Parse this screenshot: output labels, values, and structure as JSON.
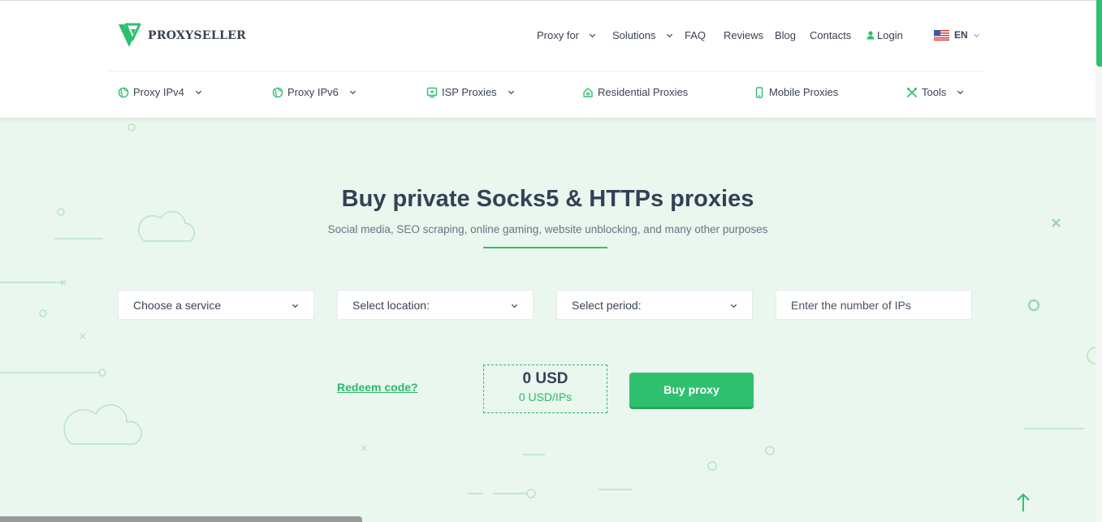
{
  "brand": {
    "name": "PROXYSELLER"
  },
  "top_nav": [
    {
      "label": "Proxy for",
      "dropdown": true
    },
    {
      "label": "Solutions",
      "dropdown": true
    },
    {
      "label": "FAQ",
      "dropdown": false
    },
    {
      "label": "Reviews",
      "dropdown": false
    },
    {
      "label": "Blog",
      "dropdown": false
    },
    {
      "label": "Contacts",
      "dropdown": false
    },
    {
      "label": "Login",
      "icon": "user-icon"
    },
    {
      "label": "EN",
      "icon": "us-flag-icon",
      "dropdown": true
    }
  ],
  "sub_nav": [
    {
      "label": "Proxy IPv4",
      "icon": "globe-icon",
      "dropdown": true
    },
    {
      "label": "Proxy IPv6",
      "icon": "globe-icon",
      "dropdown": true
    },
    {
      "label": "ISP Proxies",
      "icon": "isp-icon",
      "dropdown": true
    },
    {
      "label": "Residential Proxies",
      "icon": "home-icon",
      "dropdown": false
    },
    {
      "label": "Mobile Proxies",
      "icon": "phone-icon",
      "dropdown": false
    },
    {
      "label": "Tools",
      "icon": "tools-icon",
      "dropdown": true
    }
  ],
  "hero": {
    "title": "Buy private Socks5 & HTTPs proxies",
    "subtitle": "Social media, SEO scraping, online gaming, website unblocking, and many other purposes"
  },
  "order_form": {
    "service": "Choose a service",
    "location": "Select location:",
    "period": "Select period:",
    "ip_count_placeholder": "Enter the number of IPs",
    "redeem_label": "Redeem code?",
    "total_price": "0 USD",
    "price_per_ip": "0 USD/IPs",
    "buy_label": "Buy proxy"
  },
  "colors": {
    "accent": "#2fc06f",
    "hero_background": "#eaf7ef",
    "text_dark": "#334155",
    "text_muted": "#6b7480"
  }
}
